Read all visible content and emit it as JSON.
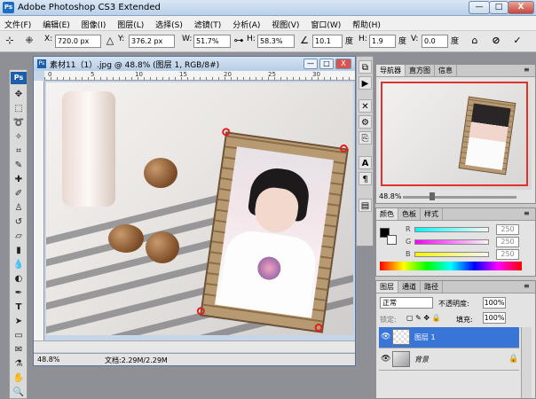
{
  "app": {
    "title": "Adobe Photoshop CS3 Extended",
    "logo": "Ps"
  },
  "window_controls": {
    "minimize": "—",
    "maximize": "□",
    "close": "X"
  },
  "menu": [
    "文件(F)",
    "编辑(E)",
    "图像(I)",
    "图层(L)",
    "选择(S)",
    "滤镜(T)",
    "分析(A)",
    "视图(V)",
    "窗口(W)",
    "帮助(H)"
  ],
  "options": {
    "x_label": "X:",
    "x_value": "720.0 px",
    "y_label": "Y:",
    "y_value": "376.2 px",
    "w_label": "W:",
    "w_value": "51.7%",
    "h_label": "H:",
    "h_value": "58.3%",
    "angle_value": "10.1",
    "angle_unit": "度",
    "hskew_label": "H:",
    "hskew_value": "1.9",
    "hskew_unit": "度",
    "vskew_label": "V:",
    "vskew_value": "0.0",
    "vskew_unit": "度"
  },
  "document": {
    "title": "素材11（1）.jpg @ 48.8% (图层 1, RGB/8#)",
    "ruler_marks": [
      "0",
      "5",
      "10",
      "15",
      "20",
      "25",
      "30"
    ],
    "zoom": "48.8%",
    "doc_info": "文档:2.29M/2.29M"
  },
  "navigator": {
    "tabs": [
      "导航器",
      "直方图",
      "信息"
    ],
    "zoom": "48.8%"
  },
  "color_panel": {
    "tabs": [
      "颜色",
      "色板",
      "样式"
    ],
    "channels": [
      {
        "label": "R",
        "value": "250",
        "gradient": "linear-gradient(90deg,#05f6f6,#f5f6f6)"
      },
      {
        "label": "G",
        "value": "250",
        "gradient": "linear-gradient(90deg,#f605f6,#f6f6f6)"
      },
      {
        "label": "B",
        "value": "250",
        "gradient": "linear-gradient(90deg,#f6f605,#f6f6f6)"
      }
    ]
  },
  "layers_panel": {
    "tabs": [
      "图层",
      "通道",
      "路径"
    ],
    "blend_mode": "正常",
    "opacity_label": "不透明度:",
    "opacity_value": "100%",
    "lock_label": "锁定:",
    "fill_label": "填充:",
    "fill_value": "100%",
    "layers": [
      {
        "name": "图层 1",
        "active": true
      },
      {
        "name": "背景",
        "active": false
      }
    ]
  }
}
